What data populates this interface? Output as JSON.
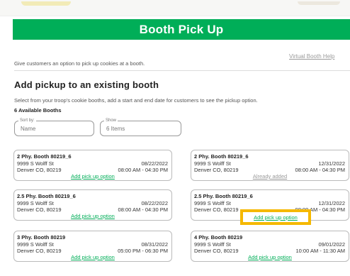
{
  "colors": {
    "banner": "#00ae58",
    "link": "#00ae58",
    "disabled_link": "#9a9a9a",
    "highlight": "#f5b800"
  },
  "banner": {
    "title": "Booth Pick Up"
  },
  "help_link": "Virtual Booth Help",
  "intro": "Give customers an option to pick up cookies at a booth.",
  "section": {
    "title": "Add pickup to an existing booth",
    "instructions": "Select from your troop's cookie booths, add a start and end date for customers to see the pickup option.",
    "count": "6 Available Booths"
  },
  "filters": {
    "sort": {
      "label": "Sort by:",
      "value": "Name"
    },
    "show": {
      "label": "Show",
      "value": "6 Items"
    }
  },
  "booths": [
    {
      "name": "2 Phy. Booth 80219_6",
      "address": "9999 S Wolff St",
      "city": "Denver CO, 80219",
      "date": "08/22/2022",
      "time": "08:00 AM - 04:30 PM",
      "action": "Add pick up option"
    },
    {
      "name": "2 Phy. Booth 80219_6",
      "address": "9999 S Wolff St",
      "city": "Denver CO, 80219",
      "date": "12/31/2022",
      "time": "08:00 AM - 04:30 PM",
      "action": "Already added"
    },
    {
      "name": "2.5 Phy. Booth 80219_6",
      "address": "9999 S Wolff St",
      "city": "Denver CO, 80219",
      "date": "08/22/2022",
      "time": "08:00 AM - 04:30 PM",
      "action": "Add pick up option"
    },
    {
      "name": "2.5 Phy. Booth 80219_6",
      "address": "9999 S Wolff St",
      "city": "Denver CO, 80219",
      "date": "12/31/2022",
      "time": "08:00 AM - 04:30 PM",
      "action": "Add pick up option"
    },
    {
      "name": "3 Phy. Booth 80219",
      "address": "9999 S Wolff St",
      "city": "Denver CO, 80219",
      "date": "08/31/2022",
      "time": "05:00 PM - 06:30 PM",
      "action": "Add pick up option"
    },
    {
      "name": "4 Phy. Booth 80219",
      "address": "9999 S Wolff St",
      "city": "Denver CO, 80219",
      "date": "09/01/2022",
      "time": "10:00 AM - 11:30 AM",
      "action": "Add pick up option"
    }
  ]
}
